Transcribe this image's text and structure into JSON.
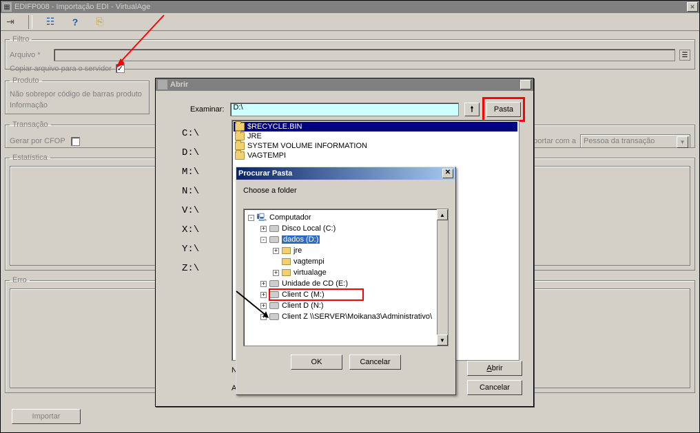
{
  "window": {
    "title": "EDIFP008 - Importação EDI - VirtualAge"
  },
  "toolbar": {
    "run_icon": "▶",
    "help_icon": "?",
    "exit_icon": "⍈"
  },
  "filtro": {
    "legend": "Filtro",
    "arquivo_label": "Arquivo *",
    "copiar_label": "Copiar arquivo para o servidor"
  },
  "produto": {
    "legend": "Produto",
    "line1": "Não sobrepor código de barras produto",
    "line2": "Informação"
  },
  "transacao": {
    "legend": "Transação",
    "line1": "Gerar por CFOP",
    "right_label": "portar com a",
    "select_value": "Pessoa da transação"
  },
  "estatistica": {
    "legend": "Estatística"
  },
  "erro": {
    "legend": "Erro"
  },
  "importar_btn": "Importar",
  "abrir_dialog": {
    "title": "Abrir",
    "examinar_label": "Examinar:",
    "examinar_value": "D:\\",
    "pasta_btn": "Pasta",
    "drives": [
      "C:\\",
      "D:\\",
      "M:\\",
      "N:\\",
      "V:\\",
      "X:\\",
      "Y:\\",
      "Z:\\"
    ],
    "files": [
      "$RECYCLE.BIN",
      "JRE",
      "SYSTEM VOLUME INFORMATION",
      "VAGTEMPI"
    ],
    "nome_label": "Nom",
    "arquivos_label": "Arqu",
    "abrir_btn": "Abrir",
    "cancelar_btn": "Cancelar"
  },
  "browse_dialog": {
    "title": "Procurar Pasta",
    "prompt": "Choose a folder",
    "tree": [
      {
        "indent": 0,
        "exp": "-",
        "icon": "computer",
        "label": "Computador"
      },
      {
        "indent": 1,
        "exp": "+",
        "icon": "drive",
        "label": "Disco Local (C:)"
      },
      {
        "indent": 1,
        "exp": "-",
        "icon": "drive",
        "label": "dados (D:)",
        "selected": true
      },
      {
        "indent": 2,
        "exp": "+",
        "icon": "folder",
        "label": "jre"
      },
      {
        "indent": 2,
        "exp": "",
        "icon": "folder",
        "label": "vagtempi"
      },
      {
        "indent": 2,
        "exp": "+",
        "icon": "folder",
        "label": "virtualage"
      },
      {
        "indent": 1,
        "exp": "+",
        "icon": "drive",
        "label": "Unidade de CD (E:)"
      },
      {
        "indent": 1,
        "exp": "+",
        "icon": "drive",
        "label": "Client C (M:)",
        "highlight": true
      },
      {
        "indent": 1,
        "exp": "+",
        "icon": "drive",
        "label": "Client D (N:)"
      },
      {
        "indent": 1,
        "exp": "+",
        "icon": "drive",
        "label": "Client Z \\\\SERVER\\Moikana3\\Administrativo\\"
      }
    ],
    "ok_btn": "OK",
    "cancelar_btn": "Cancelar"
  }
}
